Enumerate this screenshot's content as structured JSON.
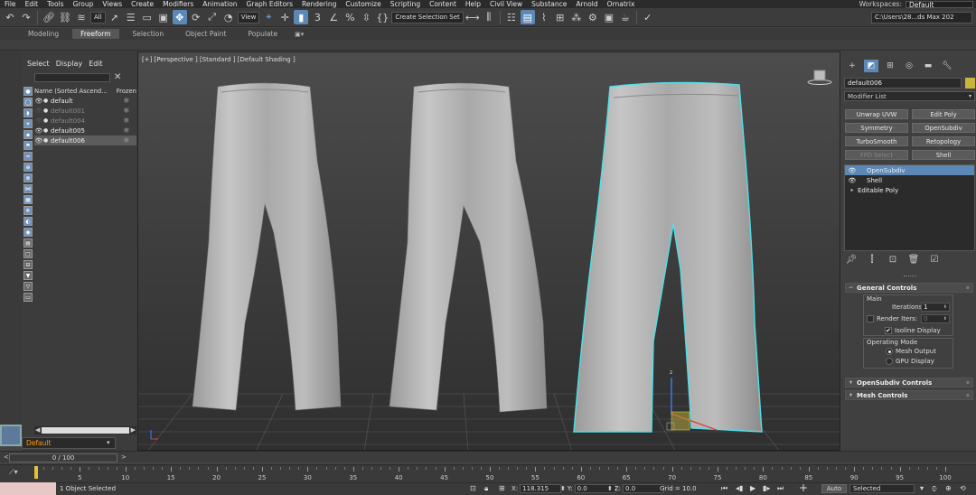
{
  "menubar": {
    "items": [
      "File",
      "Edit",
      "Tools",
      "Group",
      "Views",
      "Create",
      "Modifiers",
      "Animation",
      "Graph Editors",
      "Rendering",
      "Customize",
      "Scripting",
      "Content",
      "Help",
      "Civil View",
      "Substance",
      "Arnold",
      "Ornatrix"
    ],
    "workspace_label": "Workspaces:",
    "workspace_value": "Default"
  },
  "toolbar": {
    "filter_value": "All",
    "view_value": "View",
    "create_selection_set": "Create Selection Set",
    "path_value": "C:\\Users\\28...ds Max 202"
  },
  "ribbon": {
    "tabs": [
      "Modeling",
      "Freeform",
      "Selection",
      "Object Paint",
      "Populate"
    ],
    "active": "Freeform",
    "toggle": "▣▾"
  },
  "scene_explorer": {
    "menu": [
      "Select",
      "Display",
      "Edit"
    ],
    "col_name": "Name (Sorted Ascend...",
    "col_frozen": "Frozen",
    "rows": [
      {
        "name": "default",
        "visible": true,
        "selected": false
      },
      {
        "name": "default001",
        "visible": false,
        "selected": false
      },
      {
        "name": "default004",
        "visible": false,
        "selected": false
      },
      {
        "name": "default005",
        "visible": true,
        "selected": false
      },
      {
        "name": "default006",
        "visible": true,
        "selected": true
      }
    ],
    "layer": "Default"
  },
  "viewport": {
    "label": "[+] [Perspective ] [Standard ] [Default Shading ]"
  },
  "command_panel": {
    "object_name": "default006",
    "object_color": "#c8b63a",
    "modifier_list": "Modifier List",
    "buttons": [
      {
        "label": "Unwrap UVW",
        "disabled": false
      },
      {
        "label": "Edit Poly",
        "disabled": false
      },
      {
        "label": "Symmetry",
        "disabled": false
      },
      {
        "label": "OpenSubdiv",
        "disabled": false
      },
      {
        "label": "TurboSmooth",
        "disabled": false
      },
      {
        "label": "Retopology",
        "disabled": false
      },
      {
        "label": "FFD Select",
        "disabled": true
      },
      {
        "label": "Shell",
        "disabled": false
      }
    ],
    "stack": [
      {
        "name": "OpenSubdiv",
        "selected": true,
        "type": "eye"
      },
      {
        "name": "Shell",
        "selected": false,
        "type": "eye"
      },
      {
        "name": "Editable Poly",
        "selected": false,
        "type": "tri"
      }
    ],
    "general_controls": {
      "title": "General Controls",
      "main_label": "Main",
      "iterations_label": "Iterations:",
      "iterations_value": "1",
      "render_iters_label": "Render Iters:",
      "render_iters_value": "0",
      "render_iters_checked": false,
      "isoline_label": "Isoline Display",
      "isoline_checked": true,
      "operating_mode_label": "Operating Mode",
      "mesh_output_label": "Mesh Output",
      "gpu_display_label": "GPU Display",
      "mode": "mesh_output"
    },
    "rollouts": [
      "OpenSubdiv Controls",
      "Mesh Controls"
    ]
  },
  "timeline": {
    "slider_text": "0 / 100",
    "ticks": [
      5,
      10,
      15,
      20,
      25,
      30,
      35,
      40,
      45,
      50,
      55,
      60,
      65,
      70,
      75,
      80,
      85,
      90,
      95,
      100
    ]
  },
  "status": {
    "objects_selected": "1 Object Selected",
    "x_label": "X:",
    "x_value": "118.315",
    "y_label": "Y:",
    "y_value": "0.0",
    "z_label": "Z:",
    "z_value": "0.0",
    "grid": "Grid = 10.0",
    "auto_label": "Auto",
    "selected_dd": "Selected"
  },
  "colors": {
    "accent_blue": "#5b88b6",
    "selection_cyan": "#4fe0ea",
    "layer_orange": "#ff9900",
    "time_cursor": "#e1c135"
  }
}
